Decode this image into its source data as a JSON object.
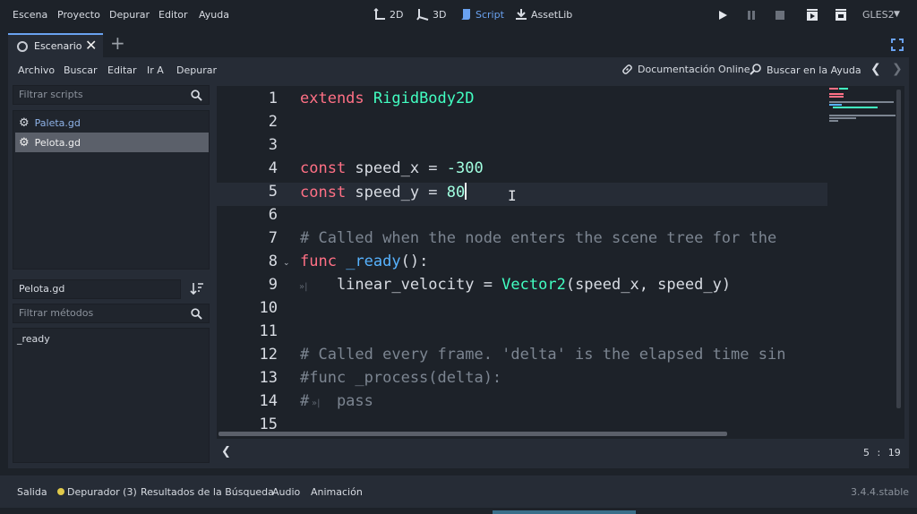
{
  "menu": [
    "Escena",
    "Proyecto",
    "Depurar",
    "Editor",
    "Ayuda"
  ],
  "workspaces": {
    "two_d": "2D",
    "three_d": "3D",
    "script": "Script",
    "assetlib": "AssetLib"
  },
  "renderer": "GLES2",
  "scene_tab": "Escenario",
  "script_menu": [
    "Archivo",
    "Buscar",
    "Editar",
    "Ir A",
    "Depurar"
  ],
  "help": {
    "online_docs": "Documentación Online",
    "search_help": "Buscar en la Ayuda"
  },
  "scripts": {
    "filter_placeholder": "Filtrar scripts",
    "items": [
      "Paleta.gd",
      "Pelota.gd"
    ],
    "current": "Pelota.gd"
  },
  "methods": {
    "filter_placeholder": "Filtrar métodos",
    "items": [
      "_ready"
    ]
  },
  "code_lines": [
    {
      "n": "1",
      "parts": [
        [
          "kw",
          "extends "
        ],
        [
          "ty",
          "RigidBody2D"
        ]
      ]
    },
    {
      "n": "2",
      "parts": []
    },
    {
      "n": "3",
      "parts": []
    },
    {
      "n": "4",
      "parts": [
        [
          "kw",
          "const"
        ],
        [
          "",
          " speed_x = "
        ],
        [
          "num",
          "-300"
        ]
      ]
    },
    {
      "n": "5",
      "parts": [
        [
          "kw",
          "const"
        ],
        [
          "",
          " speed_y = "
        ],
        [
          "num",
          "80"
        ]
      ]
    },
    {
      "n": "6",
      "parts": []
    },
    {
      "n": "7",
      "parts": [
        [
          "com",
          "# Called when the node enters the scene tree for the"
        ]
      ]
    },
    {
      "n": "8",
      "parts": [
        [
          "kw",
          "func"
        ],
        [
          "",
          " "
        ],
        [
          "fn",
          "_ready"
        ],
        [
          "",
          "():"
        ]
      ]
    },
    {
      "n": "9",
      "parts": [
        [
          "",
          "    linear_velocity = "
        ],
        [
          "ty",
          "Vector2"
        ],
        [
          "",
          "(speed_x, speed_y)"
        ]
      ]
    },
    {
      "n": "10",
      "parts": []
    },
    {
      "n": "11",
      "parts": []
    },
    {
      "n": "12",
      "parts": [
        [
          "com",
          "# Called every frame. 'delta' is the elapsed time sin"
        ]
      ]
    },
    {
      "n": "13",
      "parts": [
        [
          "com",
          "#func _process(delta):"
        ]
      ]
    },
    {
      "n": "14",
      "parts": [
        [
          "com",
          "#   pass"
        ]
      ]
    },
    {
      "n": "15",
      "parts": []
    }
  ],
  "cursor": {
    "line": "5",
    "sep": ":",
    "col": "19"
  },
  "bottom_tabs": [
    "Salida",
    "Depurador (3)",
    "Resultados de la Búsqueda",
    "Audio",
    "Animación"
  ],
  "version": "3.4.4.stable",
  "colors": {
    "accent": "#6aa2f0",
    "keyword": "#ff7085",
    "type": "#42ffc2",
    "number": "#a1ffe0",
    "function": "#57b3ff",
    "comment": "#7c8591",
    "debugger_dot": "#e0c94a"
  }
}
